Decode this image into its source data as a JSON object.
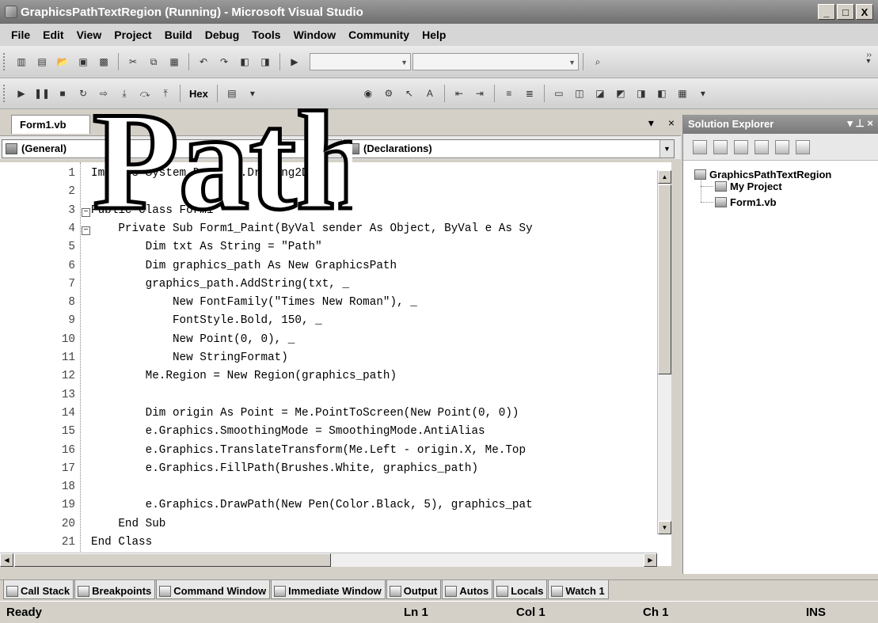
{
  "window": {
    "title": "GraphicsPathTextRegion (Running) - Microsoft Visual Studio",
    "buttons": [
      "_",
      "□",
      "X"
    ]
  },
  "menu": [
    "File",
    "Edit",
    "View",
    "Project",
    "Build",
    "Debug",
    "Tools",
    "Window",
    "Community",
    "Help"
  ],
  "toolbar2": {
    "hex_label": "Hex"
  },
  "editor": {
    "tab_label": "Form1.vb",
    "close_glyph": "×",
    "dropdown_glyph": "▾",
    "left_combo": "(General)",
    "right_combo": "(Declarations)",
    "lines": [
      {
        "num": "1",
        "text": "Imports System.Drawing.Drawing2D"
      },
      {
        "num": "2",
        "text": ""
      },
      {
        "num": "3",
        "text": "Public Class Form1"
      },
      {
        "num": "4",
        "text": "    Private Sub Form1_Paint(ByVal sender As Object, ByVal e As Sy"
      },
      {
        "num": "5",
        "text": "        Dim txt As String = \"Path\""
      },
      {
        "num": "6",
        "text": "        Dim graphics_path As New GraphicsPath"
      },
      {
        "num": "7",
        "text": "        graphics_path.AddString(txt, _"
      },
      {
        "num": "8",
        "text": "            New FontFamily(\"Times New Roman\"), _"
      },
      {
        "num": "9",
        "text": "            FontStyle.Bold, 150, _"
      },
      {
        "num": "10",
        "text": "            New Point(0, 0), _"
      },
      {
        "num": "11",
        "text": "            New StringFormat)"
      },
      {
        "num": "12",
        "text": "        Me.Region = New Region(graphics_path)"
      },
      {
        "num": "13",
        "text": ""
      },
      {
        "num": "14",
        "text": "        Dim origin As Point = Me.PointToScreen(New Point(0, 0))"
      },
      {
        "num": "15",
        "text": "        e.Graphics.SmoothingMode = SmoothingMode.AntiAlias"
      },
      {
        "num": "16",
        "text": "        e.Graphics.TranslateTransform(Me.Left - origin.X, Me.Top"
      },
      {
        "num": "17",
        "text": "        e.Graphics.FillPath(Brushes.White, graphics_path)"
      },
      {
        "num": "18",
        "text": ""
      },
      {
        "num": "19",
        "text": "        e.Graphics.DrawPath(New Pen(Color.Black, 5), graphics_pat"
      },
      {
        "num": "20",
        "text": "    End Sub"
      },
      {
        "num": "21",
        "text": "End Class"
      }
    ]
  },
  "overlay_text": "Path",
  "solution_explorer": {
    "title": "Solution Explorer",
    "pin_glyph": "▾ ⊥ ×",
    "items": [
      "GraphicsPathTextRegion",
      "My Project",
      "Form1.vb"
    ]
  },
  "bottom_tabs": [
    "Call Stack",
    "Breakpoints",
    "Command Window",
    "Immediate Window",
    "Output",
    "Autos",
    "Locals",
    "Watch 1"
  ],
  "status": {
    "state": "Ready",
    "ln": "Ln 1",
    "col": "Col 1",
    "ch": "Ch 1",
    "mode": "INS"
  }
}
